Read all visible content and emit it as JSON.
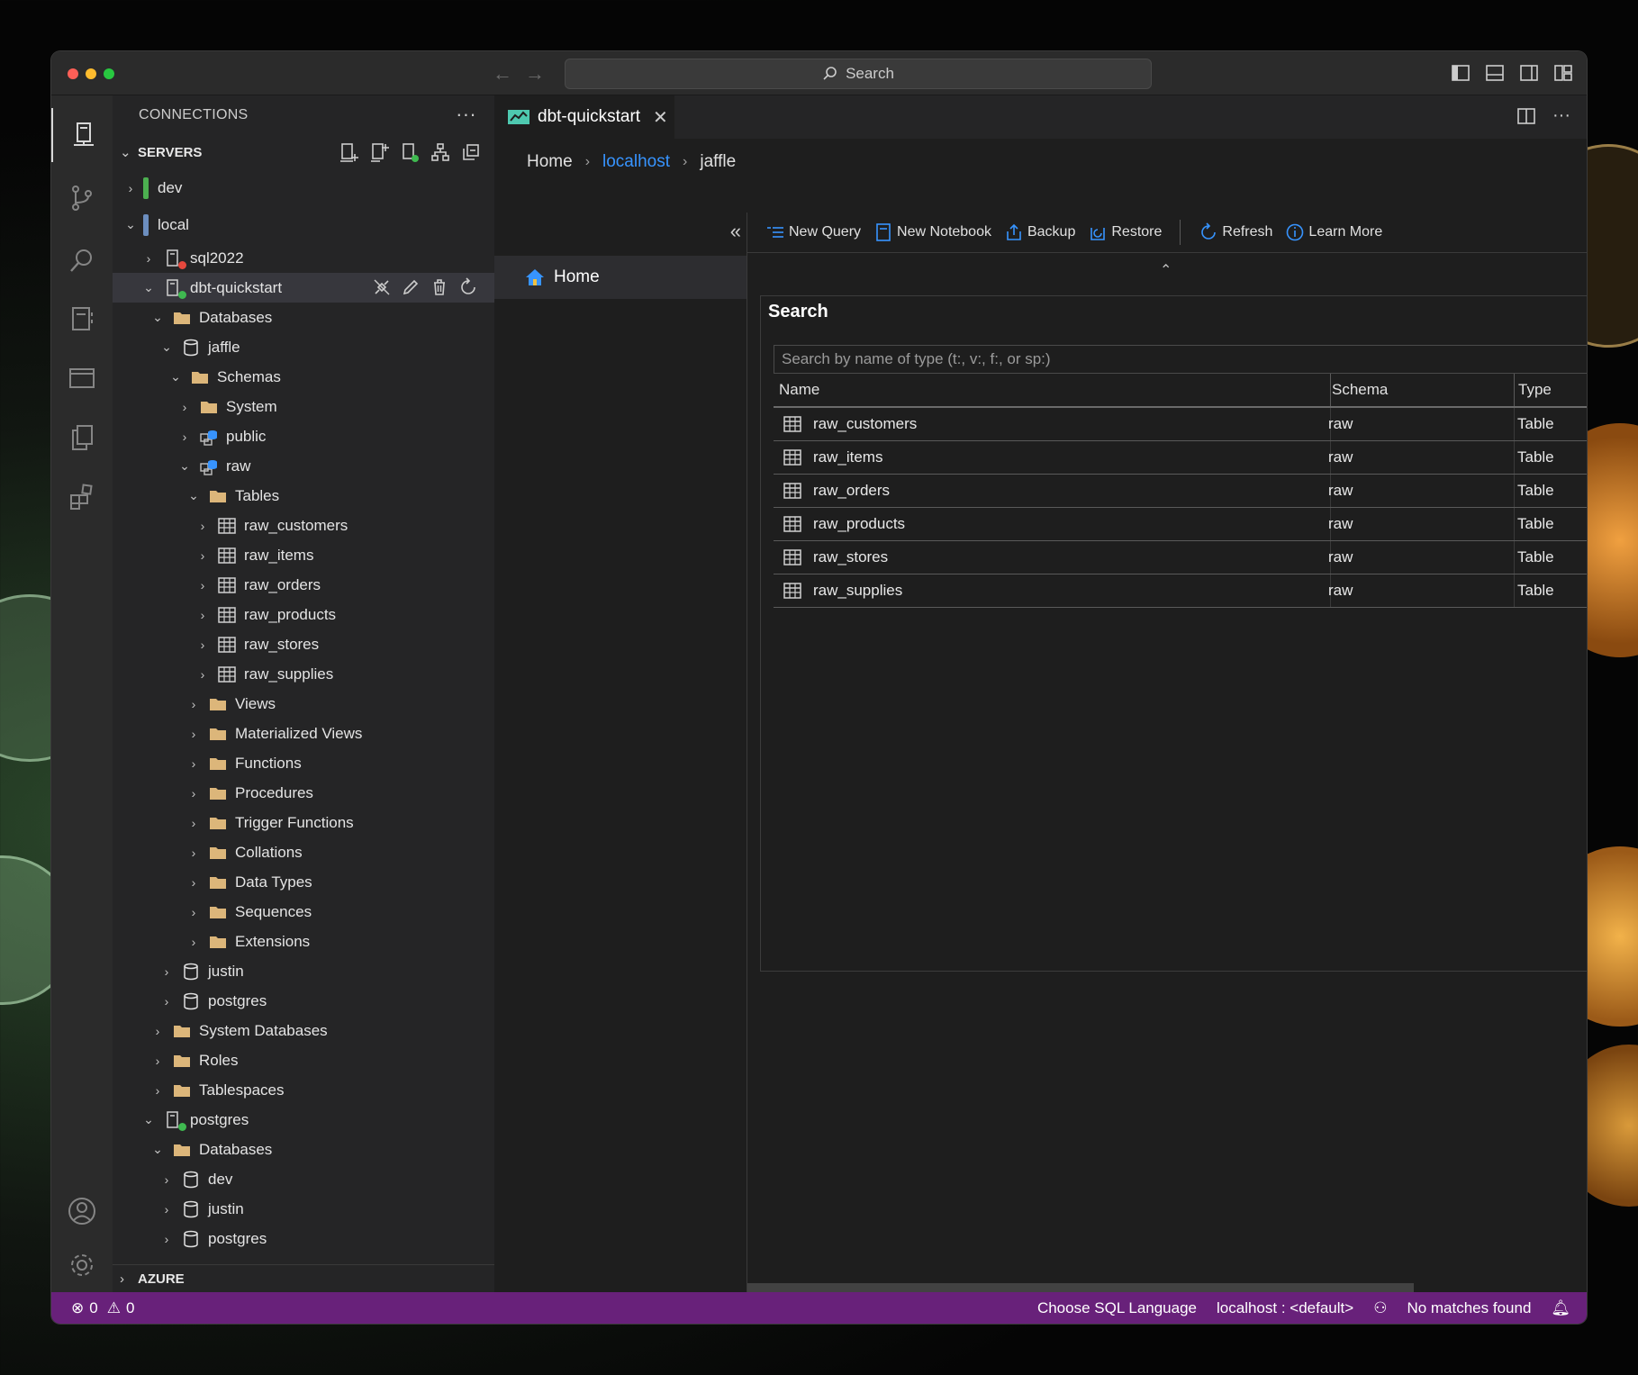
{
  "window": {
    "search_placeholder": "Search"
  },
  "sidebar": {
    "header": "CONNECTIONS",
    "more": "···",
    "servers_label": "SERVERS",
    "azure_label": "AZURE",
    "tree": [
      {
        "level": 0,
        "twist": "›",
        "kind": "group",
        "color": "#4caf50",
        "label": "dev"
      },
      {
        "level": 0,
        "twist": "⌄",
        "kind": "group",
        "color": "#6c8ebf",
        "label": "local"
      },
      {
        "level": 1,
        "twist": "›",
        "kind": "server",
        "status": "#e5483d",
        "label": "sql2022"
      },
      {
        "level": 1,
        "twist": "⌄",
        "kind": "server",
        "status": "#3fb950",
        "label": "dbt-quickstart",
        "selected": true
      },
      {
        "level": 2,
        "twist": "⌄",
        "kind": "folder",
        "label": "Databases"
      },
      {
        "level": 3,
        "twist": "⌄",
        "kind": "database",
        "label": "jaffle"
      },
      {
        "level": 4,
        "twist": "⌄",
        "kind": "folder",
        "label": "Schemas"
      },
      {
        "level": 5,
        "twist": "›",
        "kind": "folder",
        "label": "System"
      },
      {
        "level": 5,
        "twist": "›",
        "kind": "schema",
        "label": "public"
      },
      {
        "level": 5,
        "twist": "⌄",
        "kind": "schema",
        "label": "raw"
      },
      {
        "level": 6,
        "twist": "⌄",
        "kind": "folder",
        "label": "Tables"
      },
      {
        "level": 7,
        "twist": "›",
        "kind": "table",
        "label": "raw_customers"
      },
      {
        "level": 7,
        "twist": "›",
        "kind": "table",
        "label": "raw_items"
      },
      {
        "level": 7,
        "twist": "›",
        "kind": "table",
        "label": "raw_orders"
      },
      {
        "level": 7,
        "twist": "›",
        "kind": "table",
        "label": "raw_products"
      },
      {
        "level": 7,
        "twist": "›",
        "kind": "table",
        "label": "raw_stores"
      },
      {
        "level": 7,
        "twist": "›",
        "kind": "table",
        "label": "raw_supplies"
      },
      {
        "level": 6,
        "twist": "›",
        "kind": "folder",
        "label": "Views"
      },
      {
        "level": 6,
        "twist": "›",
        "kind": "folder",
        "label": "Materialized Views"
      },
      {
        "level": 6,
        "twist": "›",
        "kind": "folder",
        "label": "Functions"
      },
      {
        "level": 6,
        "twist": "›",
        "kind": "folder",
        "label": "Procedures"
      },
      {
        "level": 6,
        "twist": "›",
        "kind": "folder",
        "label": "Trigger Functions"
      },
      {
        "level": 6,
        "twist": "›",
        "kind": "folder",
        "label": "Collations"
      },
      {
        "level": 6,
        "twist": "›",
        "kind": "folder",
        "label": "Data Types"
      },
      {
        "level": 6,
        "twist": "›",
        "kind": "folder",
        "label": "Sequences"
      },
      {
        "level": 6,
        "twist": "›",
        "kind": "folder",
        "label": "Extensions"
      },
      {
        "level": 3,
        "twist": "›",
        "kind": "database",
        "label": "justin"
      },
      {
        "level": 3,
        "twist": "›",
        "kind": "database",
        "label": "postgres"
      },
      {
        "level": 2,
        "twist": "›",
        "kind": "folder",
        "label": "System Databases"
      },
      {
        "level": 2,
        "twist": "›",
        "kind": "folder",
        "label": "Roles"
      },
      {
        "level": 2,
        "twist": "›",
        "kind": "folder",
        "label": "Tablespaces"
      },
      {
        "level": 1,
        "twist": "⌄",
        "kind": "server",
        "status": "#3fb950",
        "label": "postgres"
      },
      {
        "level": 2,
        "twist": "⌄",
        "kind": "folder",
        "label": "Databases"
      },
      {
        "level": 3,
        "twist": "›",
        "kind": "database",
        "label": "dev"
      },
      {
        "level": 3,
        "twist": "›",
        "kind": "database",
        "label": "justin"
      },
      {
        "level": 3,
        "twist": "›",
        "kind": "database",
        "label": "postgres"
      }
    ]
  },
  "editor": {
    "tab_label": "dbt-quickstart",
    "tab_close": "✕",
    "breadcrumb": {
      "home": "Home",
      "server": "localhost",
      "database": "jaffle"
    },
    "nav": {
      "collapse": "«",
      "home": "Home"
    },
    "toolbar": {
      "new_query": "New Query",
      "new_notebook": "New Notebook",
      "backup": "Backup",
      "restore": "Restore",
      "refresh": "Refresh",
      "learn_more": "Learn More"
    },
    "search": {
      "title": "Search",
      "placeholder": "Search by name of type (t:, v:, f:, or sp:)",
      "columns": {
        "name": "Name",
        "schema": "Schema",
        "type": "Type"
      },
      "rows": [
        {
          "name": "raw_customers",
          "schema": "raw",
          "type": "Table"
        },
        {
          "name": "raw_items",
          "schema": "raw",
          "type": "Table"
        },
        {
          "name": "raw_orders",
          "schema": "raw",
          "type": "Table"
        },
        {
          "name": "raw_products",
          "schema": "raw",
          "type": "Table"
        },
        {
          "name": "raw_stores",
          "schema": "raw",
          "type": "Table"
        },
        {
          "name": "raw_supplies",
          "schema": "raw",
          "type": "Table"
        }
      ]
    }
  },
  "statusbar": {
    "errors": "0",
    "warnings": "0",
    "language": "Choose SQL Language",
    "connection": "localhost : <default>",
    "matches": "No matches found"
  },
  "colors": {
    "accent": "#3794ff",
    "statusbar": "#68217a",
    "folder": "#dcb67a"
  }
}
